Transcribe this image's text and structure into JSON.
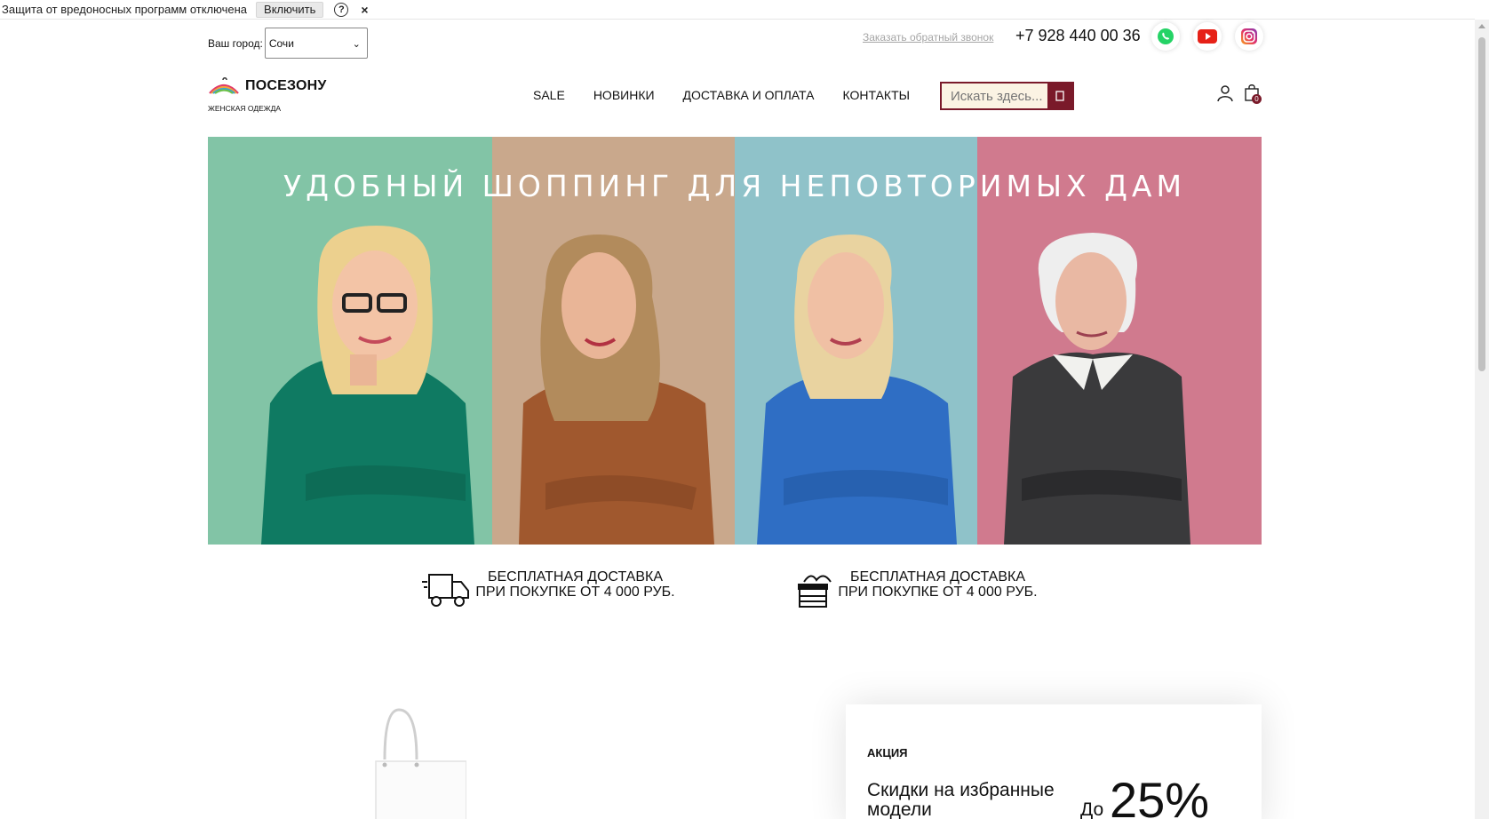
{
  "protection_bar": {
    "message": "Защита от вредоносных программ отключена",
    "enable_label": "Включить",
    "help_label": "?",
    "close_label": "×"
  },
  "topbar": {
    "city_label": "Ваш город:",
    "city_value": "Сочи",
    "callback_label": "Заказать обратный звонок",
    "phone": "+7 928 440 00 36",
    "social_icons": [
      "whatsapp-icon",
      "youtube-icon",
      "instagram-icon"
    ]
  },
  "header": {
    "brand": "ПОСЕЗОНУ",
    "tagline": "ЖЕНСКАЯ ОДЕЖДА",
    "nav": [
      "SALE",
      "НОВИНКИ",
      "ДОСТАВКА И ОПЛАТА",
      "КОНТАКТЫ"
    ],
    "search_placeholder": "Искать здесь...",
    "cart_count": "0"
  },
  "banner": {
    "title": "УДОБНЫЙ ШОППИНГ ДЛЯ НЕПОВТОРИМЫХ ДАМ",
    "panel_colors": [
      "#82c4a6",
      "#c9a88c",
      "#8fc2c9",
      "#d07a8e"
    ]
  },
  "features": [
    {
      "icon": "delivery-truck-icon",
      "text": "БЕСПЛАТНАЯ ДОСТАВКА ПРИ ПОКУПКЕ ОТ 4 000 РУБ."
    },
    {
      "icon": "gift-box-icon",
      "text": "БЕСПЛАТНАЯ ДОСТАВКА ПРИ ПОКУПКЕ ОТ 4 000 РУБ."
    }
  ],
  "promo": {
    "tag": "АКЦИЯ",
    "description": "Скидки на избранные модели",
    "upto": "До",
    "percent": "25%"
  },
  "colors": {
    "accent": "#7a1a2a",
    "search_bg": "#fbf3e3"
  }
}
